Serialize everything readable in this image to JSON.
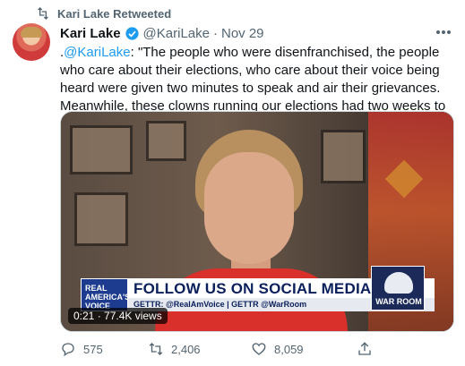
{
  "retweet_context": {
    "label": "Kari Lake Retweeted",
    "icon": "retweet-icon"
  },
  "tweet": {
    "author_name": "Kari Lake",
    "verified_icon": "verified-badge-icon",
    "handle": "@KariLake",
    "separator": "·",
    "date": "Nov 29",
    "more_icon": "more-icon",
    "text_prefix": ".",
    "text_mention": "@KariLake",
    "text_body": ": \"The people who were disenfranchised, the people who care about their elections, who care about their voice being heard were given two minutes to speak and air their grievances. Meanwhile, these clowns running our elections had two weeks to count the votes.\""
  },
  "media": {
    "banner_logo": "REAL AMERICA'S VOICE",
    "banner_headline": "FOLLOW US ON SOCIAL MEDIA",
    "banner_sub": "GETTR: @RealAmVoice | GETTR @WarRoom",
    "warroom_logo": "WAR ROOM",
    "video_stats": "0:21 · 77.4K views"
  },
  "actions": {
    "reply_count": "575",
    "retweet_count": "2,406",
    "like_count": "8,059"
  },
  "colors": {
    "accent": "#1d9bf0",
    "secondary_text": "#536471",
    "primary_text": "#0f1419"
  }
}
